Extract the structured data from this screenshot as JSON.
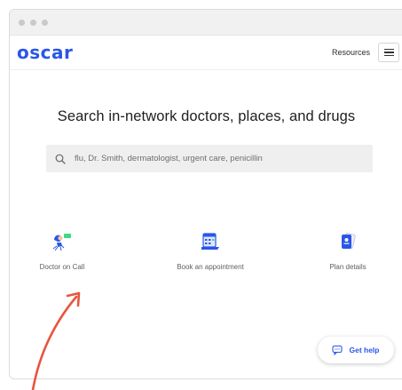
{
  "window": {
    "controls": [
      "close",
      "minimize",
      "maximize"
    ]
  },
  "navbar": {
    "logo": "oscar",
    "resources_label": "Resources",
    "menu_icon": "hamburger-menu-icon"
  },
  "hero": {
    "headline": "Search in-network doctors, places, and drugs"
  },
  "search": {
    "icon": "search-icon",
    "placeholder": "flu, Dr. Smith, dermatologist, urgent care, penicillin",
    "value": ""
  },
  "features": [
    {
      "label": "Doctor on Call",
      "icon": "doctor-on-call-icon"
    },
    {
      "label": "Book an appointment",
      "icon": "calendar-appointment-icon"
    },
    {
      "label": "Plan details",
      "icon": "plan-card-icon"
    }
  ],
  "help_button": {
    "label": "Get help",
    "icon": "chat-icon"
  },
  "annotation": {
    "icon": "red-arrow-icon",
    "color": "#e8553e"
  },
  "colors": {
    "brand": "#2a56e8",
    "accent_green": "#3ddc84",
    "arrow": "#e8553e"
  }
}
